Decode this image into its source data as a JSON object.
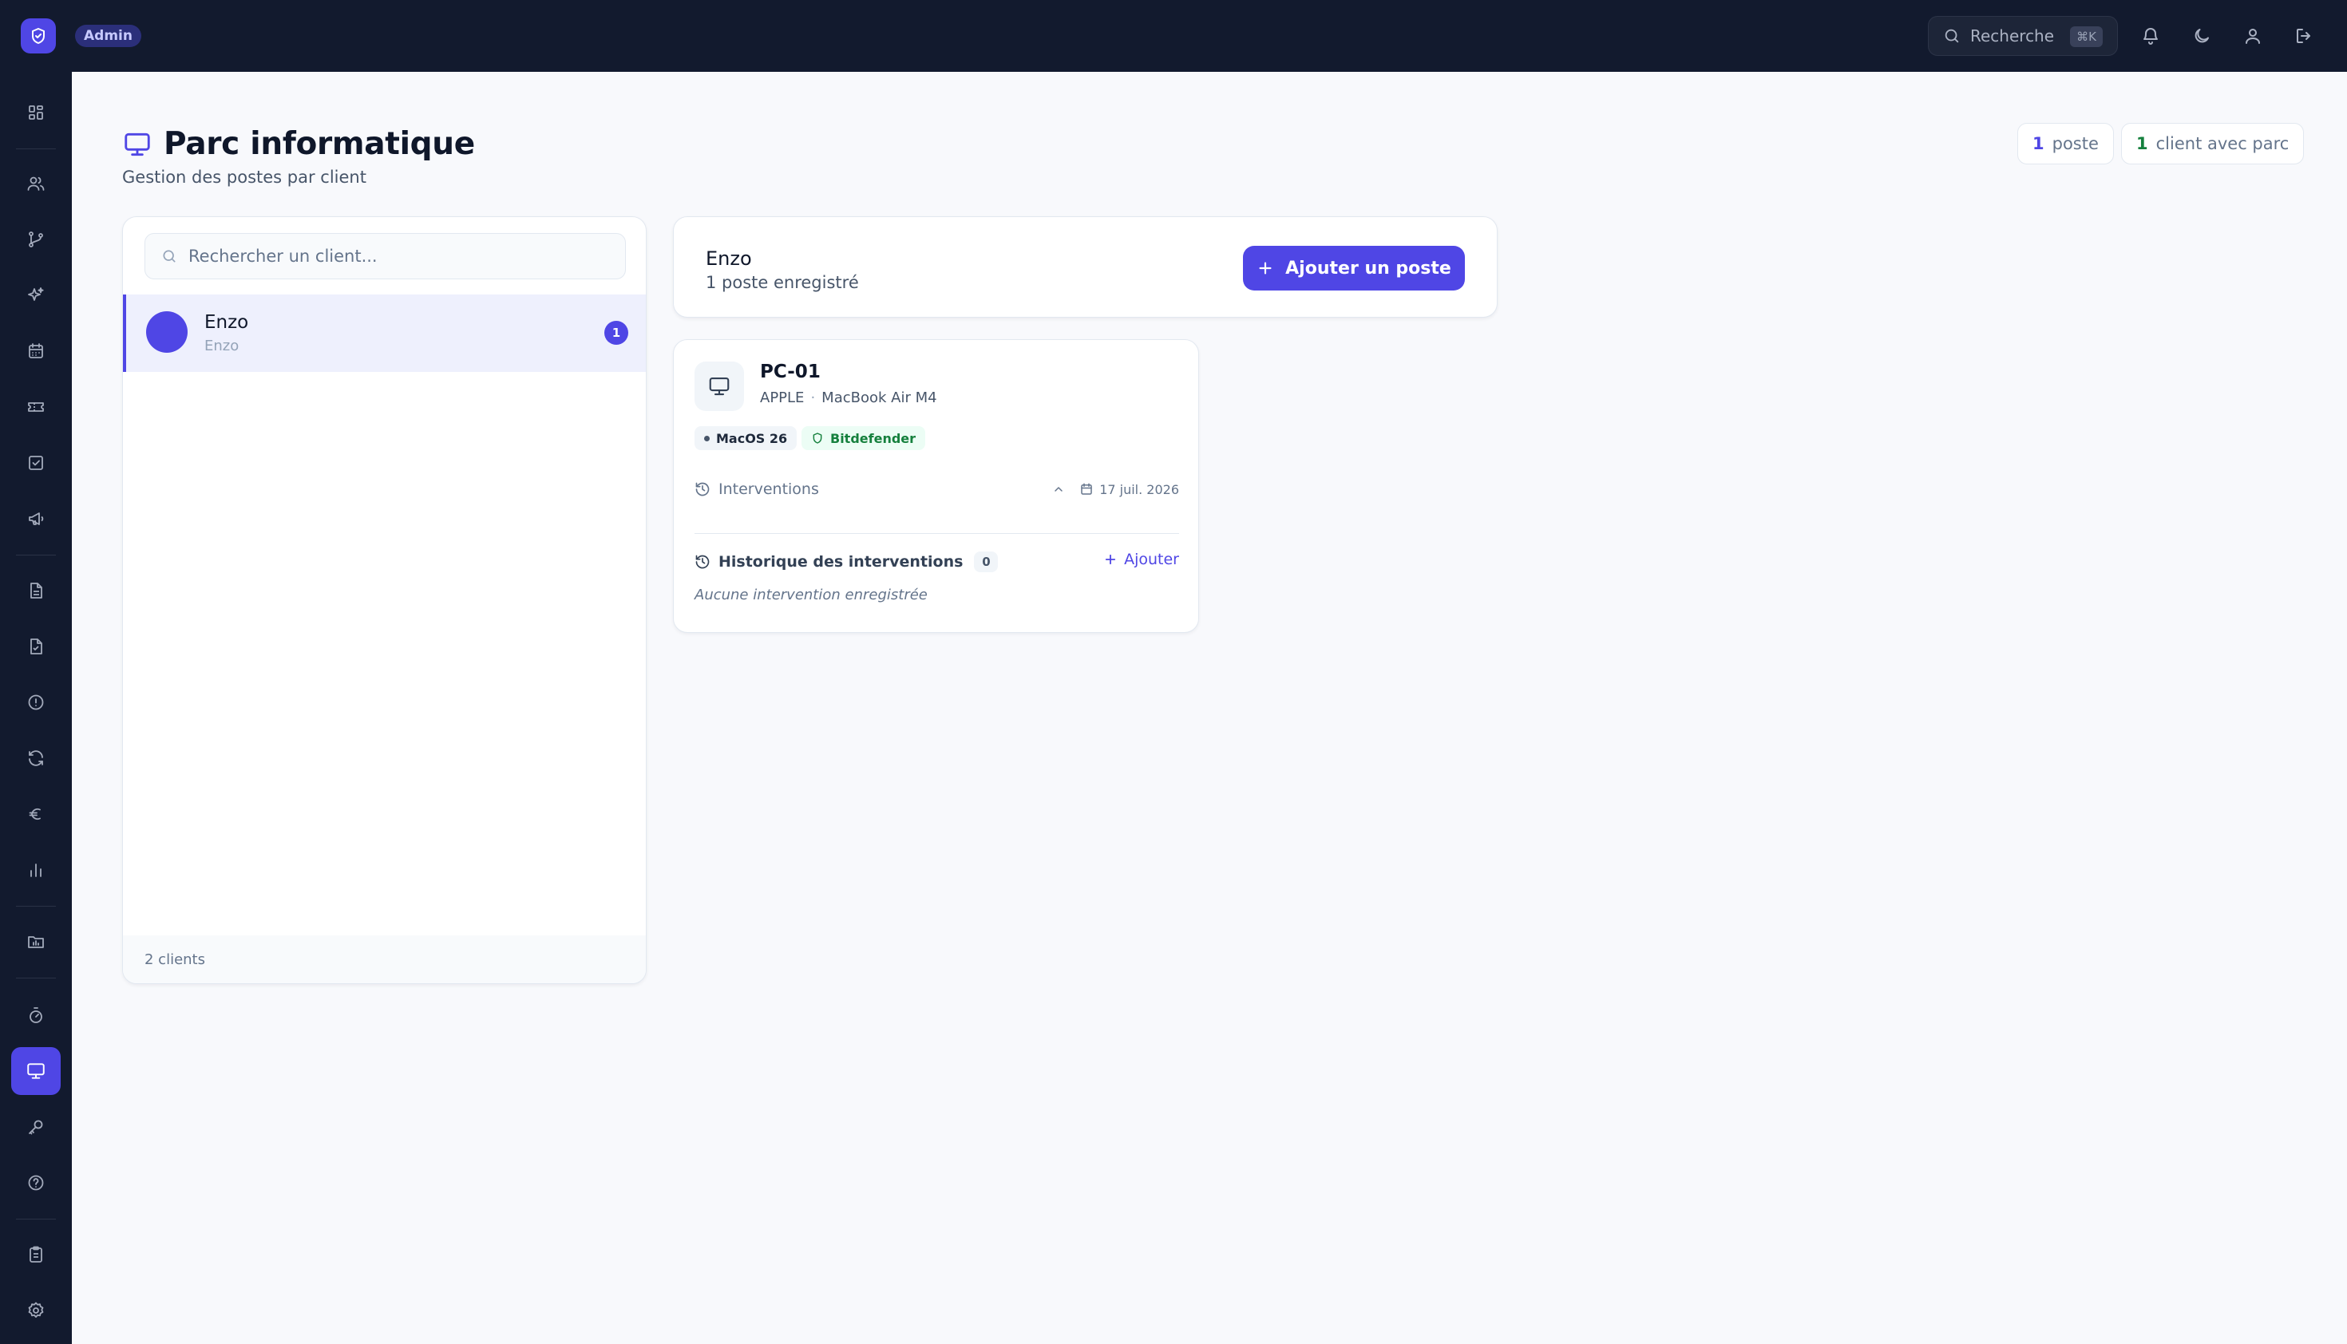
{
  "topbar": {
    "role_badge": "Admin",
    "search_label": "Recherche",
    "search_shortcut": "⌘K"
  },
  "page": {
    "title": "Parc informatique",
    "subtitle": "Gestion des postes par client"
  },
  "stats": {
    "posts_count": "1",
    "posts_label": "poste",
    "clients_count": "1",
    "clients_label": "client avec parc"
  },
  "client_list": {
    "search_placeholder": "Rechercher un client...",
    "items": [
      {
        "name": "Enzo",
        "sub": "Enzo",
        "count": "1"
      }
    ],
    "footer": "2 clients"
  },
  "selected_client": {
    "name": "Enzo",
    "summary": "1 poste enregistré",
    "add_button_label": "Ajouter un poste"
  },
  "devices": [
    {
      "name": "PC-01",
      "brand": "APPLE",
      "model": "MacBook Air M4",
      "os": "MacOS 26",
      "antivirus": "Bitdefender",
      "interventions_label": "Interventions",
      "date": "17 juil. 2026",
      "history_title": "Historique des interventions",
      "history_count": "0",
      "history_add_label": "Ajouter",
      "history_empty": "Aucune intervention enregistrée"
    }
  ],
  "colors": {
    "accent": "#4f46e5",
    "topbar": "#121a2e",
    "success": "#15803d"
  }
}
